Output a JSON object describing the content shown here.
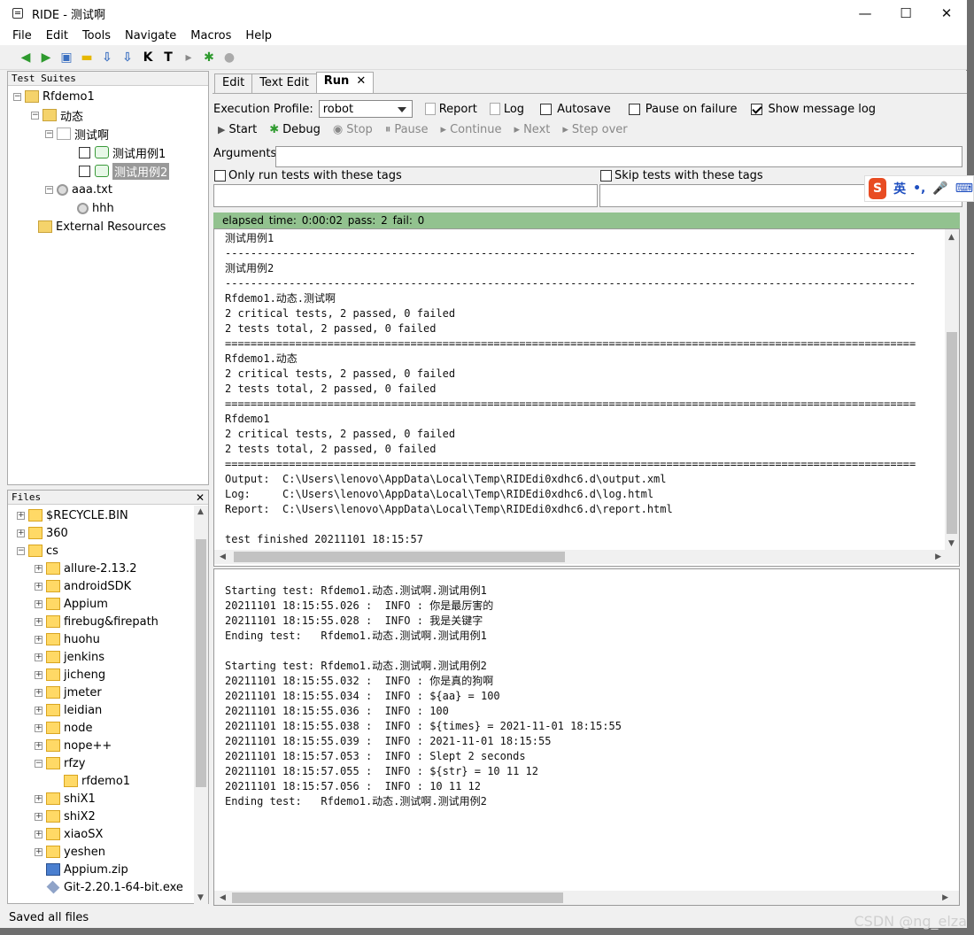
{
  "window": {
    "title": "RIDE - 测试啊",
    "min": "—",
    "max": "☐",
    "close": "✕"
  },
  "menu": [
    "File",
    "Edit",
    "Tools",
    "Navigate",
    "Macros",
    "Help"
  ],
  "toolbar": [
    "◀",
    "▶",
    "▣",
    "▬",
    "⇩",
    "⇩",
    "K",
    "T",
    "▸",
    "✱",
    "●"
  ],
  "suites": {
    "header": "Test Suites",
    "items": [
      {
        "label": "Rfdemo1",
        "exp": "−",
        "icon": "suite-folder-icon"
      },
      {
        "label": "动态",
        "exp": "−",
        "icon": "suite-folder-icon"
      },
      {
        "label": "测试啊",
        "exp": "−",
        "icon": "test-file-icon"
      },
      {
        "label": "测试用例1",
        "icon": "test-case-icon",
        "check": true
      },
      {
        "label": "测试用例2",
        "icon": "test-case-icon",
        "check": true,
        "selected": true
      },
      {
        "label": "aaa.txt",
        "exp": "−",
        "icon": "resource-gear-icon"
      },
      {
        "label": "hhh",
        "icon": "keyword-gear-icon"
      },
      {
        "label": "External Resources",
        "icon": "external-resources-icon"
      }
    ]
  },
  "files": {
    "header": "Files",
    "close": "✕",
    "items": [
      "$RECYCLE.BIN",
      "360",
      "cs",
      "allure-2.13.2",
      "androidSDK",
      "Appium",
      "firebug&firepath",
      "huohu",
      "jenkins",
      "jicheng",
      "jmeter",
      "leidian",
      "node",
      "nope++",
      "rfzy",
      "rfdemo1",
      "shiX1",
      "shiX2",
      "xiaoSX",
      "yeshen",
      "Appium.zip",
      "Git-2.20.1-64-bit.exe"
    ]
  },
  "tabs": {
    "edit": "Edit",
    "text_edit": "Text Edit",
    "run": "Run",
    "close": "✕"
  },
  "run": {
    "exec_profile_label": "Execution Profile:",
    "profile": "robot",
    "report": "Report",
    "log": "Log",
    "autosave": "Autosave",
    "pause_on_failure": "Pause on failure",
    "show_message_log": "Show message log",
    "start": "Start",
    "debug": "Debug",
    "stop": "Stop",
    "pause": "Pause",
    "continue": "Continue",
    "next": "Next",
    "step_over": "Step over",
    "arguments_label": "Arguments:",
    "only_run_tags": "Only run tests with these tags",
    "skip_tags": "Skip tests with these tags",
    "status": "elapsed time: 0:00:02     pass: 2     fail: 0"
  },
  "output_text": "测试用例1\n------------------------------------------------------------------------------------------------------------\n测试用例2\n------------------------------------------------------------------------------------------------------------\nRfdemo1.动态.测试啊\n2 critical tests, 2 passed, 0 failed\n2 tests total, 2 passed, 0 failed\n============================================================================================================\nRfdemo1.动态\n2 critical tests, 2 passed, 0 failed\n2 tests total, 2 passed, 0 failed\n============================================================================================================\nRfdemo1\n2 critical tests, 2 passed, 0 failed\n2 tests total, 2 passed, 0 failed\n============================================================================================================\nOutput:  C:\\Users\\lenovo\\AppData\\Local\\Temp\\RIDEdi0xdhc6.d\\output.xml\nLog:     C:\\Users\\lenovo\\AppData\\Local\\Temp\\RIDEdi0xdhc6.d\\log.html\nReport:  C:\\Users\\lenovo\\AppData\\Local\\Temp\\RIDEdi0xdhc6.d\\report.html\n\ntest finished 20211101 18:15:57",
  "message_log": "Starting test: Rfdemo1.动态.测试啊.测试用例1\n20211101 18:15:55.026 :  INFO : 你是最厉害的\n20211101 18:15:55.028 :  INFO : 我是关键字\nEnding test:   Rfdemo1.动态.测试啊.测试用例1\n\nStarting test: Rfdemo1.动态.测试啊.测试用例2\n20211101 18:15:55.032 :  INFO : 你是真的狗啊\n20211101 18:15:55.034 :  INFO : ${aa} = 100\n20211101 18:15:55.036 :  INFO : 100\n20211101 18:15:55.038 :  INFO : ${times} = 2021-11-01 18:15:55\n20211101 18:15:55.039 :  INFO : 2021-11-01 18:15:55\n20211101 18:15:57.053 :  INFO : Slept 2 seconds\n20211101 18:15:57.055 :  INFO : ${str} = 10 11 12\n20211101 18:15:57.056 :  INFO : 10 11 12\nEnding test:   Rfdemo1.动态.测试啊.测试用例2",
  "statusbar": "Saved all files",
  "ime": {
    "mode": "英",
    "punct": "•,",
    "mic": "🎤",
    "kbd": "⌨",
    "logo": "S"
  },
  "watermark": "CSDN @ng_elza"
}
